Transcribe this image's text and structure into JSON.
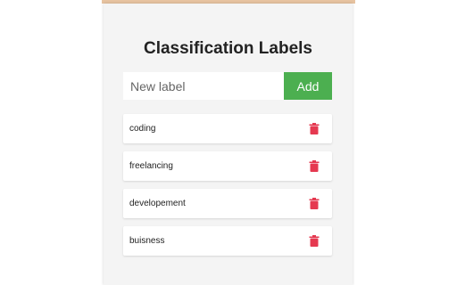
{
  "header": {
    "title": "Classification Labels"
  },
  "form": {
    "placeholder": "New label",
    "value": "",
    "add_label": "Add"
  },
  "labels": [
    {
      "text": "coding",
      "icon": "trash-icon"
    },
    {
      "text": "freelancing",
      "icon": "trash-icon"
    },
    {
      "text": "developement",
      "icon": "trash-icon"
    },
    {
      "text": "buisness",
      "icon": "trash-icon"
    }
  ],
  "colors": {
    "accent": "#4caf50",
    "delete": "#e53950",
    "panel": "#f4f4f4",
    "top_strip": "#e7c3a0"
  }
}
